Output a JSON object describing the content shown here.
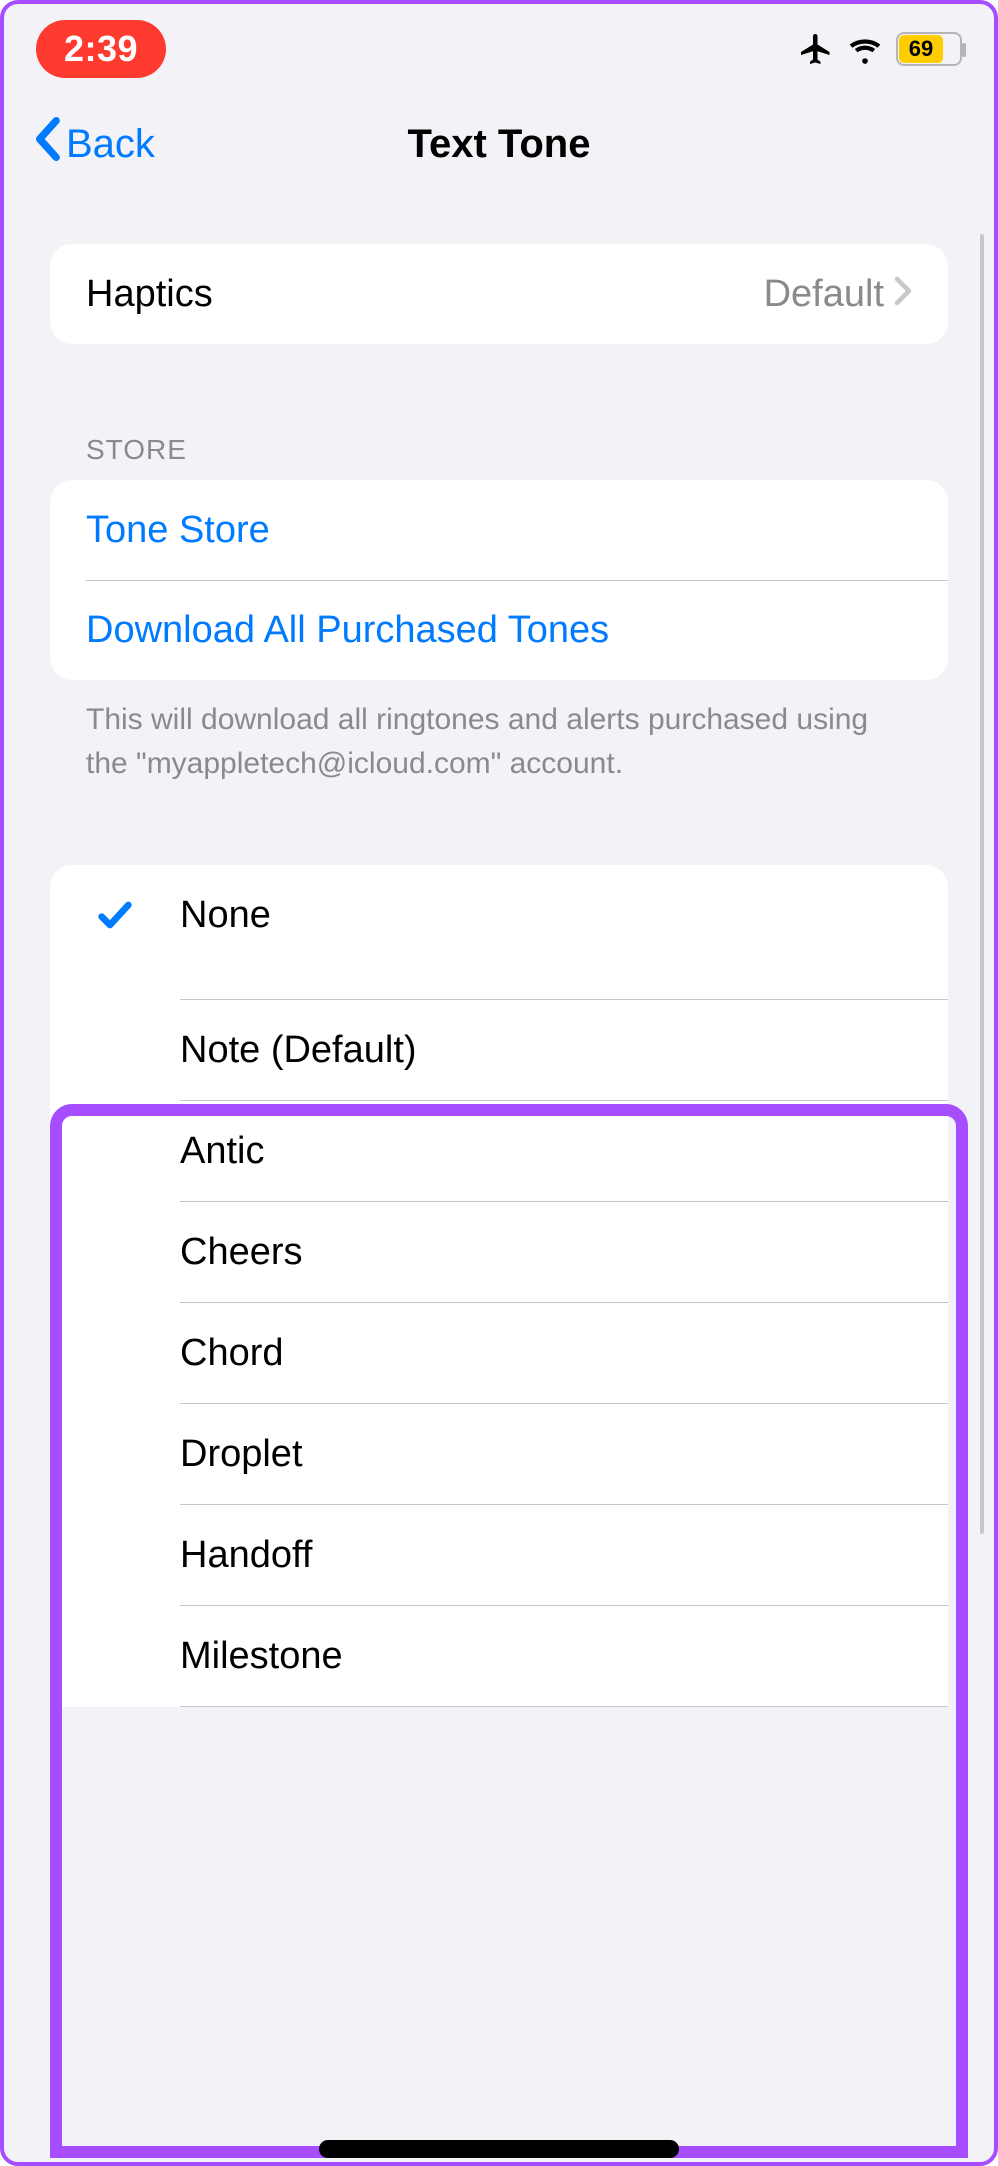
{
  "status": {
    "time": "2:39",
    "battery": "69"
  },
  "nav": {
    "back": "Back",
    "title": "Text Tone"
  },
  "haptics": {
    "label": "Haptics",
    "value": "Default"
  },
  "store": {
    "header": "STORE",
    "tone_store": "Tone Store",
    "download_all": "Download All Purchased Tones",
    "footer": "This will download all ringtones and alerts purchased using the \"myappletech@icloud.com\" account."
  },
  "tones": {
    "selected": "None",
    "items": [
      "Note (Default)",
      "Antic",
      "Cheers",
      "Chord",
      "Droplet",
      "Handoff",
      "Milestone"
    ]
  }
}
